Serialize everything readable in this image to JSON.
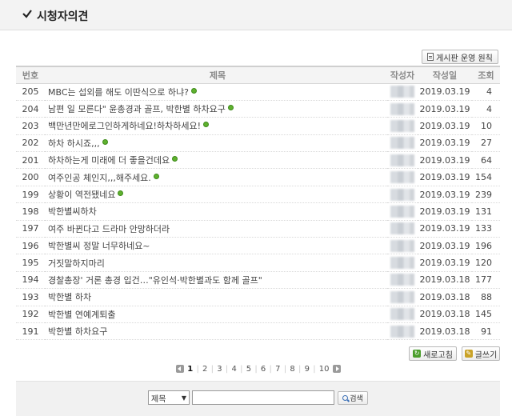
{
  "header": {
    "title": "시청자의견"
  },
  "toolbar": {
    "rules_label": "게시판 운영 원칙"
  },
  "table": {
    "headers": {
      "num": "번호",
      "title": "제목",
      "author": "작성자",
      "date": "작성일",
      "views": "조회"
    },
    "rows": [
      {
        "num": "205",
        "title": "MBC는 섭외를 해도 이딴식으로 하냐?",
        "date": "2019.03.19",
        "views": "4",
        "new": true
      },
      {
        "num": "204",
        "title": "남편 일 모른다\" 윤총경과 골프, 박한별 하차요구",
        "date": "2019.03.19",
        "views": "4",
        "new": true
      },
      {
        "num": "203",
        "title": "백만년만에로그인하게하네요!하차하세요!",
        "date": "2019.03.19",
        "views": "10",
        "new": true
      },
      {
        "num": "202",
        "title": "하차 하시죠,,,",
        "date": "2019.03.19",
        "views": "27",
        "new": true
      },
      {
        "num": "201",
        "title": "하차하는게 미래에 더 좋을건데요",
        "date": "2019.03.19",
        "views": "64",
        "new": true
      },
      {
        "num": "200",
        "title": "여주인공 체인지,,,해주세요.",
        "date": "2019.03.19",
        "views": "154",
        "new": true
      },
      {
        "num": "199",
        "title": "상황이 역전됐네요",
        "date": "2019.03.19",
        "views": "239",
        "new": true
      },
      {
        "num": "198",
        "title": "박한별씨하차",
        "date": "2019.03.19",
        "views": "131",
        "new": false
      },
      {
        "num": "197",
        "title": "여주 바뀐다고 드라마 안망하더라",
        "date": "2019.03.19",
        "views": "133",
        "new": false
      },
      {
        "num": "196",
        "title": "박한별씨 정말 너무하네요~",
        "date": "2019.03.19",
        "views": "196",
        "new": false
      },
      {
        "num": "195",
        "title": "거짓말하지마리",
        "date": "2019.03.19",
        "views": "120",
        "new": false
      },
      {
        "num": "194",
        "title": "경찰총장' 거론 총경 입건…\"유인석·박한별과도 함께 골프\"",
        "date": "2019.03.18",
        "views": "177",
        "new": false
      },
      {
        "num": "193",
        "title": "박한별 하차",
        "date": "2019.03.18",
        "views": "88",
        "new": false
      },
      {
        "num": "192",
        "title": "박한별 연예계퇴출",
        "date": "2019.03.18",
        "views": "145",
        "new": false
      },
      {
        "num": "191",
        "title": "박한별 하차요구",
        "date": "2019.03.18",
        "views": "91",
        "new": false
      }
    ]
  },
  "actions": {
    "refresh_label": "새로고침",
    "write_label": "글쓰기"
  },
  "pagination": {
    "current": 1,
    "pages": [
      "1",
      "2",
      "3",
      "4",
      "5",
      "6",
      "7",
      "8",
      "9",
      "10"
    ]
  },
  "search": {
    "field_selected": "제목",
    "input_value": "",
    "button_label": "검색"
  },
  "colors": {
    "new_badge": "#5fb12e",
    "header_bg": "#f3f3f3"
  },
  "icons": {
    "header": "checkmark-icon",
    "rules": "document-icon",
    "refresh": "refresh-icon",
    "write": "pencil-icon",
    "search": "magnifier-icon",
    "new": "new-badge-icon"
  }
}
